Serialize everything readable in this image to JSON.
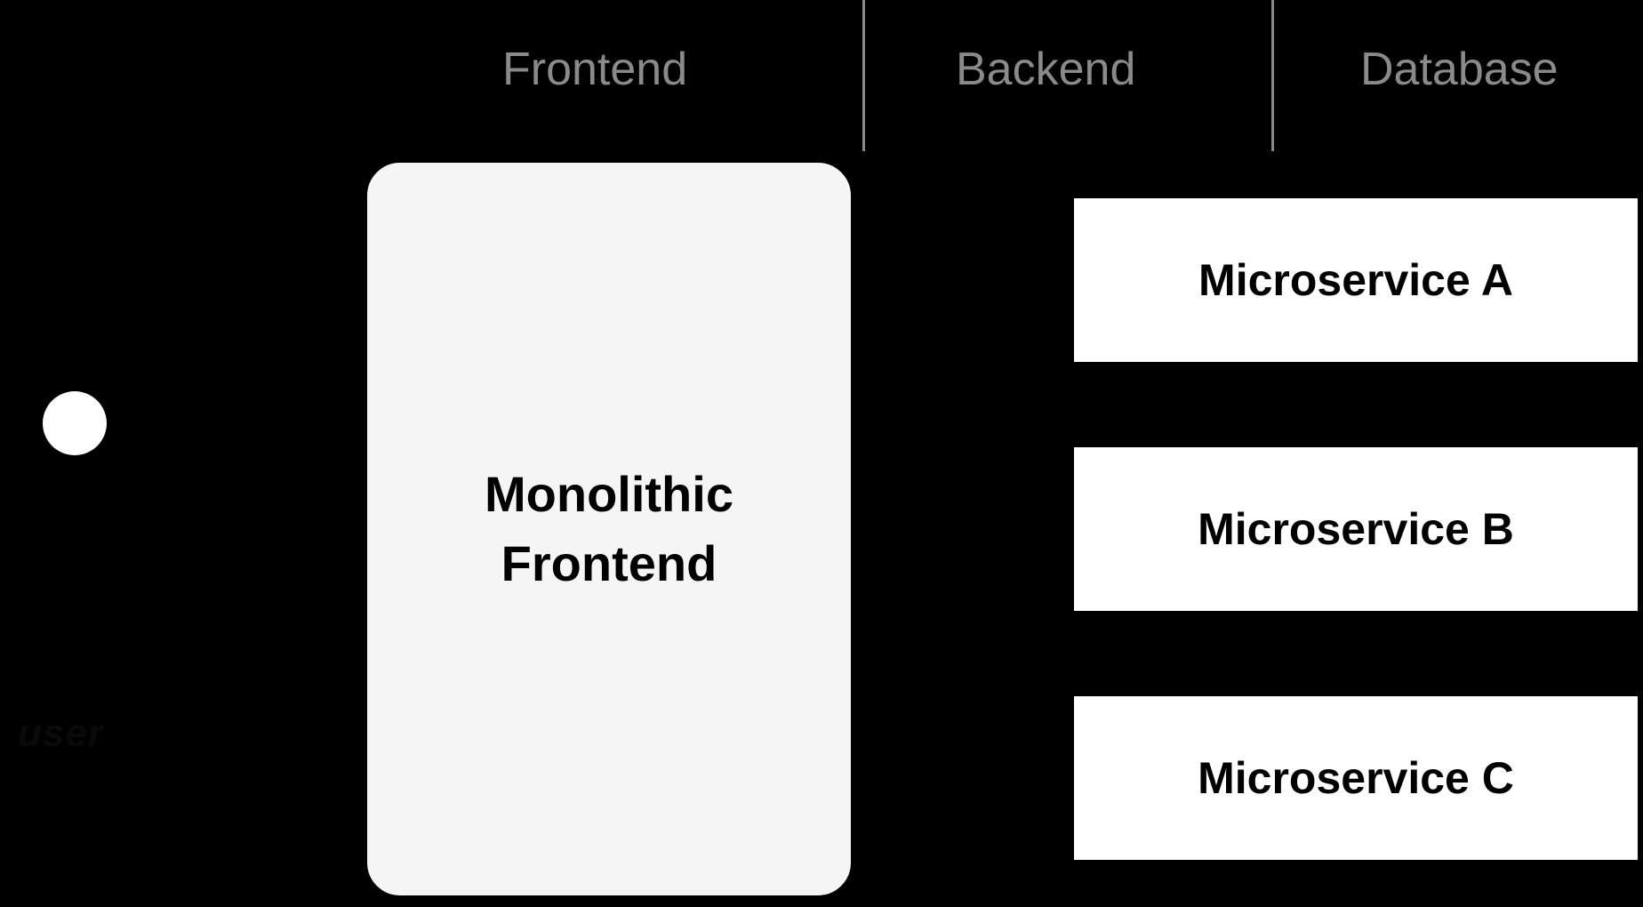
{
  "headers": {
    "frontend": "Frontend",
    "backend": "Backend",
    "database": "Database"
  },
  "user_label": "user",
  "monolith": {
    "line1": "Monolithic",
    "line2": "Frontend"
  },
  "microservices": [
    "Microservice A",
    "Microservice B",
    "Microservice C"
  ]
}
